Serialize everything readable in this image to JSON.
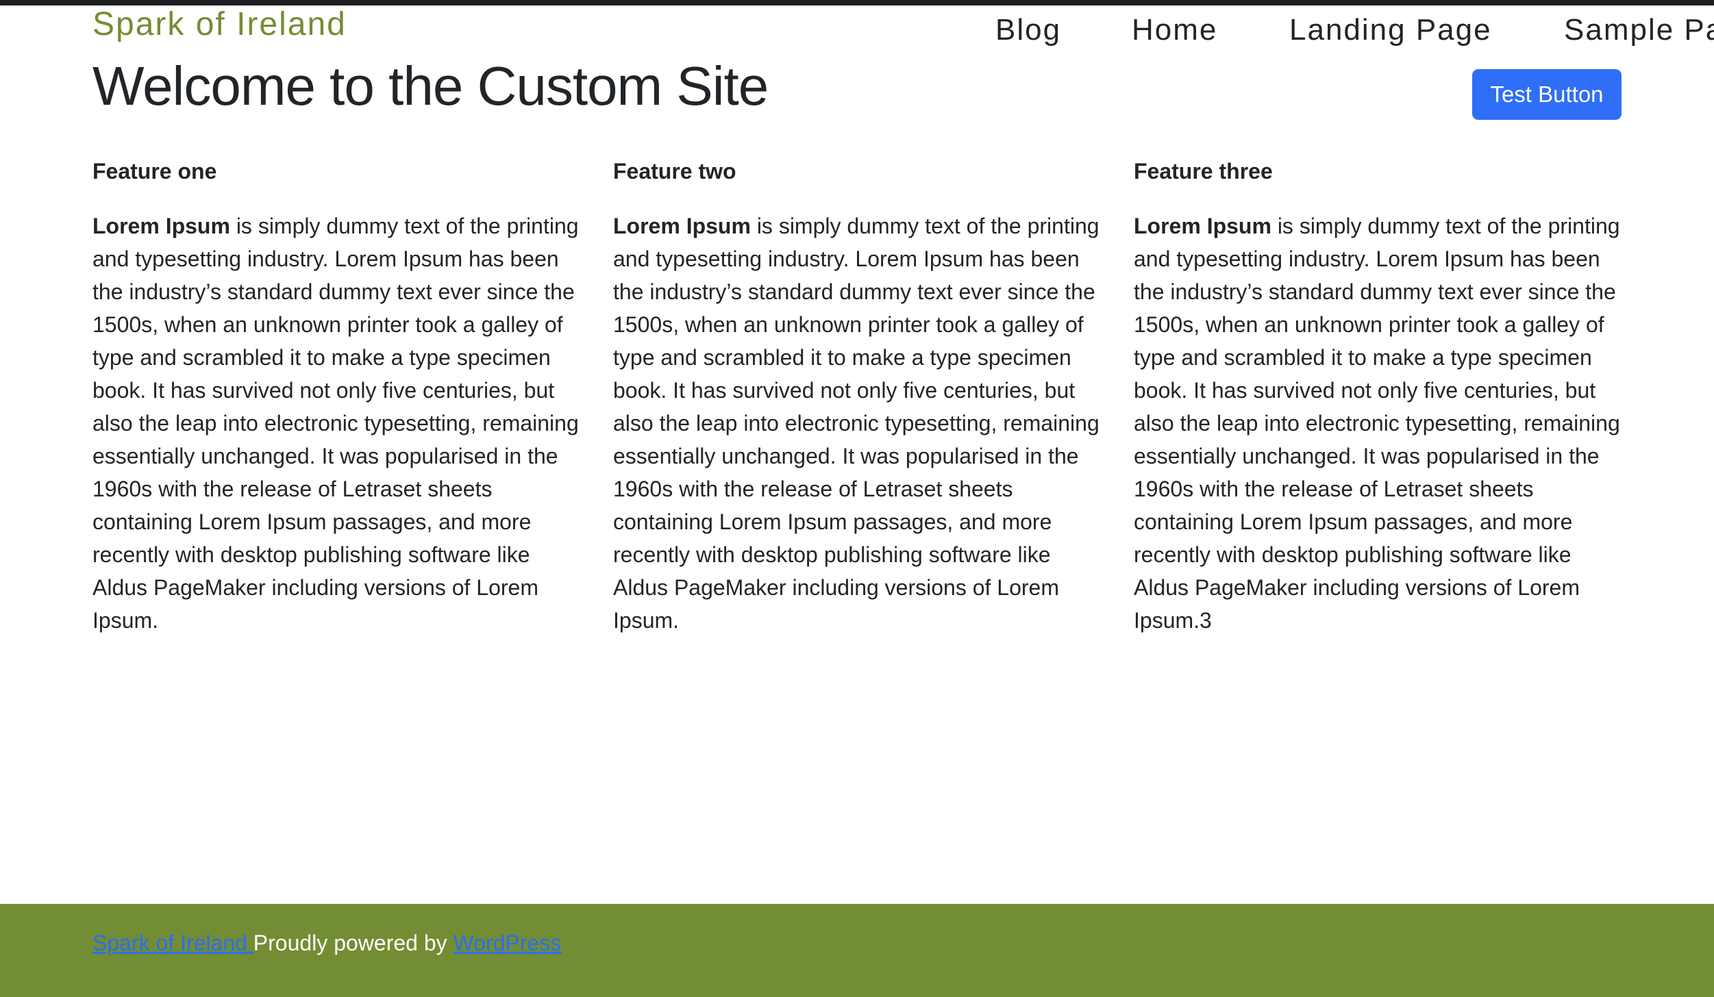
{
  "header": {
    "site_title": "Spark of Ireland",
    "nav": [
      "Blog",
      "Home",
      "Landing Page",
      "Sample Pa"
    ]
  },
  "main": {
    "heading": "Welcome to the Custom Site",
    "button_label": "Test Button",
    "features": [
      {
        "title": "Feature one",
        "lead": "Lorem Ipsum",
        "body": " is simply dummy text of the printing and typesetting industry. Lorem Ipsum has been the industry’s standard dummy text ever since the 1500s, when an unknown printer took a galley of type and scrambled it to make a type specimen book. It has survived not only five centuries, but also the leap into electronic typesetting, remaining essentially unchanged. It was popularised in the 1960s with the release of Letraset sheets containing Lorem Ipsum passages, and more recently with desktop publishing software like Aldus PageMaker including versions of Lorem Ipsum."
      },
      {
        "title": "Feature two",
        "lead": "Lorem Ipsum",
        "body": " is simply dummy text of the printing and typesetting industry. Lorem Ipsum has been the industry’s standard dummy text ever since the 1500s, when an unknown printer took a galley of type and scrambled it to make a type specimen book. It has survived not only five centuries, but also the leap into electronic typesetting, remaining essentially unchanged. It was popularised in the 1960s with the release of Letraset sheets containing Lorem Ipsum passages, and more recently with desktop publishing software like Aldus PageMaker including versions of Lorem Ipsum."
      },
      {
        "title": "Feature three",
        "lead": "Lorem Ipsum",
        "body": " is simply dummy text of the printing and typesetting industry. Lorem Ipsum has been the industry’s standard dummy text ever since the 1500s, when an unknown printer took a galley of type and scrambled it to make a type specimen book. It has survived not only five centuries, but also the leap into electronic typesetting, remaining essentially unchanged. It was popularised in the 1960s with the release of Letraset sheets containing Lorem Ipsum passages, and more recently with desktop publishing software like Aldus PageMaker including versions of Lorem Ipsum.3"
      }
    ]
  },
  "footer": {
    "site_link": "Spark of Ireland ",
    "powered_text": "Proudly powered by ",
    "wordpress_link": "WordPress"
  },
  "colors": {
    "brand_green": "#738d34",
    "button_blue": "#2f6ef7",
    "link_blue": "#2a6ef5",
    "top_bar": "#1d2023"
  }
}
